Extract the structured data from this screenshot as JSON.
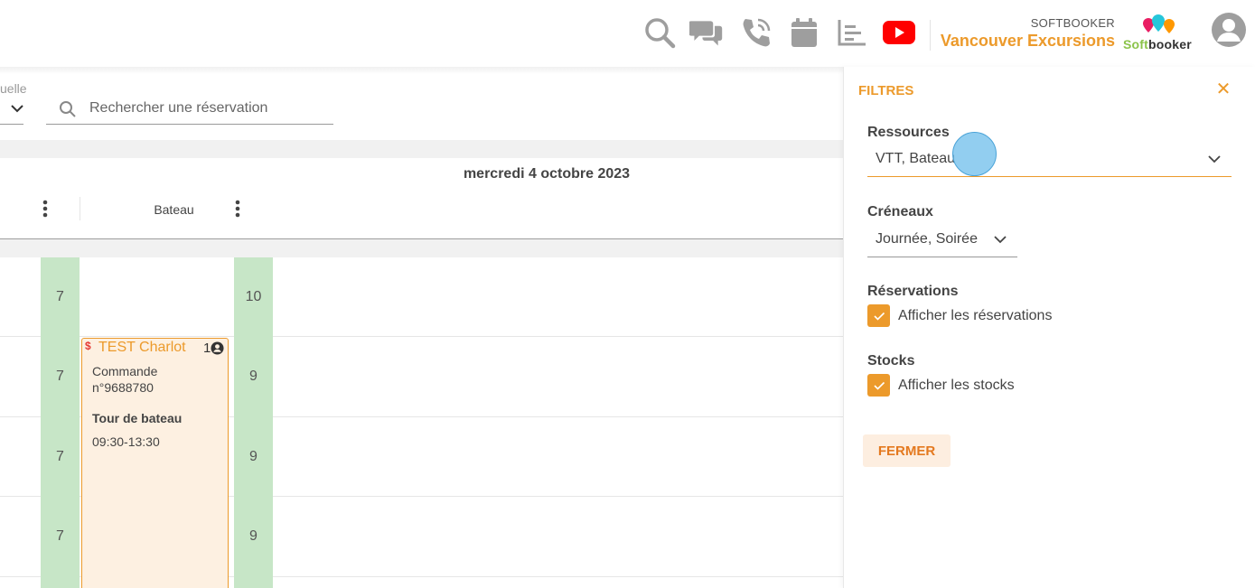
{
  "header": {
    "icons": [
      "search-icon",
      "chat-icon",
      "phone-icon",
      "calendar-icon",
      "chart-icon",
      "youtube-icon"
    ],
    "brand_small": "SOFTBOOKER",
    "brand_name": "Vancouver Excursions",
    "logo": {
      "soft": "Soft",
      "booker": "booker",
      "colors": [
        "#e91e63",
        "#26c6da",
        "#ff9800"
      ]
    },
    "avatar": "user-avatar"
  },
  "toolbar": {
    "view_label": "uelle",
    "search_placeholder": "Rechercher une réservation"
  },
  "calendar": {
    "date": "mercredi 4 octobre 2023",
    "column_header": "Bateau",
    "stock_left": [
      "7",
      "7",
      "7",
      "7"
    ],
    "stock_right": [
      "10",
      "9",
      "9",
      "9"
    ],
    "booking": {
      "name": "TEST Charlot",
      "count": "1",
      "order_line1": "Commande",
      "order_line2": "n°9688780",
      "product": "Tour de bateau",
      "time": "09:30-13:30"
    }
  },
  "filters": {
    "title": "FILTRES",
    "resources_label": "Ressources",
    "resources_value": "VTT, Bateau",
    "slots_label": "Créneaux",
    "slots_value": "Journée, Soirée",
    "reservations_label": "Réservations",
    "reservations_checkbox": "Afficher les réservations",
    "reservations_checked": true,
    "stocks_label": "Stocks",
    "stocks_checkbox": "Afficher les stocks",
    "stocks_checked": true,
    "close_button": "FERMER"
  },
  "colors": {
    "accent": "#ec9a2b",
    "stock_green": "#c7e6c7",
    "booking_bg": "#fdf0e1"
  }
}
